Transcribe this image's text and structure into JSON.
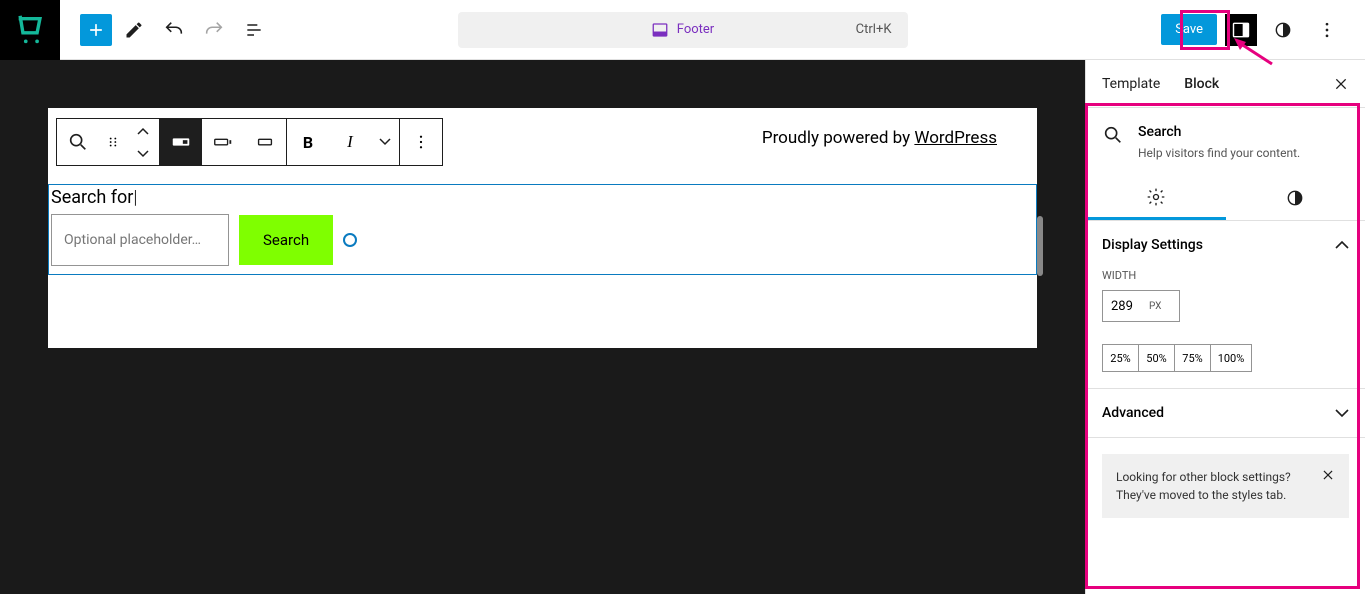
{
  "topbar": {
    "doc_title": "Footer",
    "shortcut": "Ctrl+K",
    "save_label": "Save"
  },
  "canvas": {
    "credit_prefix": "Proudly powered by ",
    "credit_link": "WordPress",
    "search_label": "Search for",
    "search_placeholder": "Optional placeholder…",
    "search_button": "Search"
  },
  "sidebar": {
    "tabs": [
      "Template",
      "Block"
    ],
    "active_tab": "Block",
    "block_title": "Search",
    "block_desc": "Help visitors find your content.",
    "panels": {
      "display": {
        "title": "Display Settings",
        "width_label": "Width",
        "width_value": "289",
        "width_unit": "PX",
        "percents": [
          "25%",
          "50%",
          "75%",
          "100%"
        ]
      },
      "advanced": {
        "title": "Advanced"
      }
    },
    "notice": "Looking for other block settings? They've moved to the styles tab."
  }
}
